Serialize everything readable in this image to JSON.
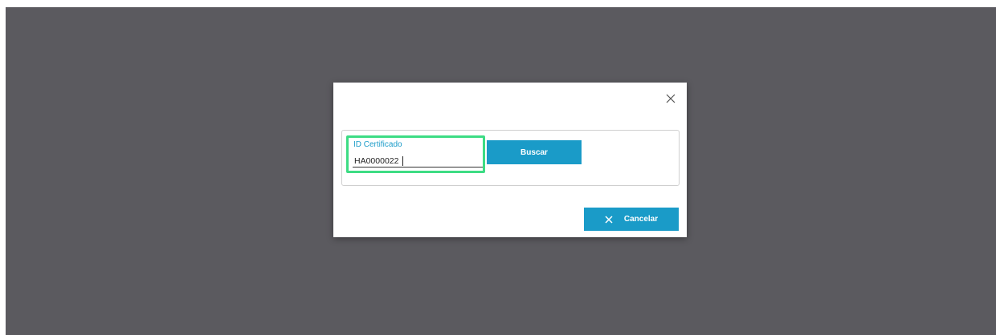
{
  "dialog": {
    "close_icon": "close-icon",
    "field": {
      "label": "ID Certificado",
      "value": "HA0000022",
      "highlight_color": "#3ddc84"
    },
    "search_button": "Buscar",
    "cancel_button": {
      "label": "Cancelar",
      "icon": "close-icon"
    },
    "accent_color": "#1a9bc8"
  }
}
